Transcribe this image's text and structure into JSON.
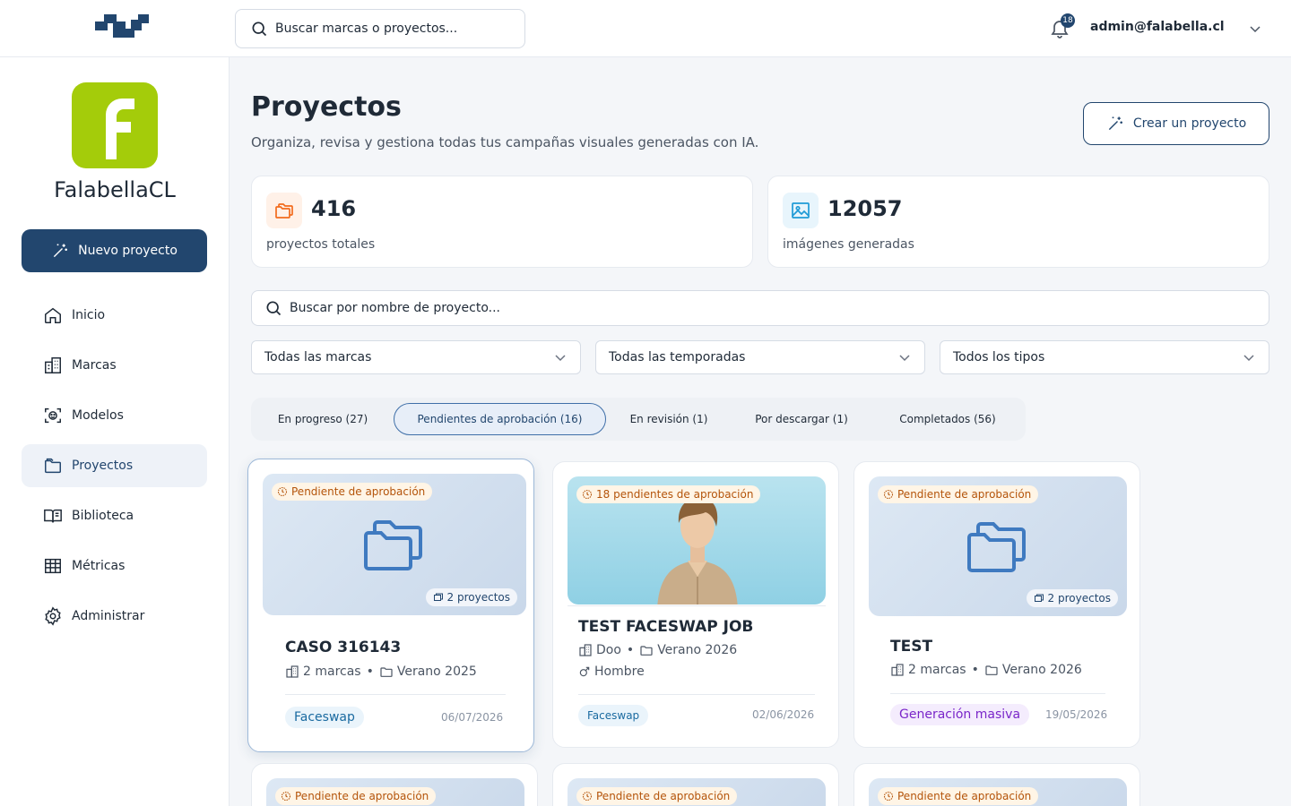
{
  "topbar": {
    "search_placeholder": "Buscar marcas o proyectos...",
    "notifications_count": "18",
    "user_email": "admin@falabella.cl"
  },
  "sidebar": {
    "brand_name": "FalabellaCL",
    "brand_letter": "f",
    "new_project_label": "Nuevo proyecto",
    "items": [
      {
        "label": "Inicio",
        "icon": "home-icon",
        "active": false
      },
      {
        "label": "Marcas",
        "icon": "building-icon",
        "active": false
      },
      {
        "label": "Modelos",
        "icon": "face-scan-icon",
        "active": false
      },
      {
        "label": "Proyectos",
        "icon": "folder-icon",
        "active": true
      },
      {
        "label": "Biblioteca",
        "icon": "book-icon",
        "active": false
      },
      {
        "label": "Métricas",
        "icon": "table-icon",
        "active": false
      },
      {
        "label": "Administrar",
        "icon": "gear-icon",
        "active": false
      }
    ]
  },
  "header": {
    "title": "Proyectos",
    "subtitle": "Organiza, revisa y gestiona todas tus campañas visuales generadas con IA.",
    "create_label": "Crear un proyecto"
  },
  "stats": [
    {
      "value": "416",
      "label": "proyectos totales",
      "color": "#f26b1d"
    },
    {
      "value": "12057",
      "label": "imágenes generadas",
      "color": "#1f9ad6"
    }
  ],
  "filters": {
    "search_placeholder": "Buscar por nombre de proyecto...",
    "brand_select": "Todas las marcas",
    "season_select": "Todas las temporadas",
    "type_select": "Todos los tipos"
  },
  "tabs": [
    {
      "label": "En progreso (27)",
      "active": false
    },
    {
      "label": "Pendientes de aprobación (16)",
      "active": true
    },
    {
      "label": "En revisión (1)",
      "active": false
    },
    {
      "label": "Por descargar (1)",
      "active": false
    },
    {
      "label": "Completados (56)",
      "active": false
    }
  ],
  "cards": [
    {
      "status": "Pendiente de aprobación",
      "count": "2 proyectos",
      "title": "CASO 316143",
      "brands": "2 marcas",
      "season": "Verano 2025",
      "tag": "Faceswap",
      "date": "06/07/2026"
    },
    {
      "status": "18 pendientes de aprobación",
      "title": "TEST FACESWAP JOB",
      "brands": "Doo",
      "season": "Verano 2026",
      "gender": "Hombre",
      "tag": "Faceswap",
      "date": "02/06/2026"
    },
    {
      "status": "Pendiente de aprobación",
      "count": "2 proyectos",
      "title": "TEST",
      "brands": "2 marcas",
      "season": "Verano 2026",
      "tag": "Generación masiva",
      "date": "19/05/2026"
    }
  ],
  "cards_row2": [
    {
      "status": "Pendiente de aprobación"
    },
    {
      "status": "Pendiente de aprobación"
    },
    {
      "status": "Pendiente de aprobación"
    }
  ]
}
